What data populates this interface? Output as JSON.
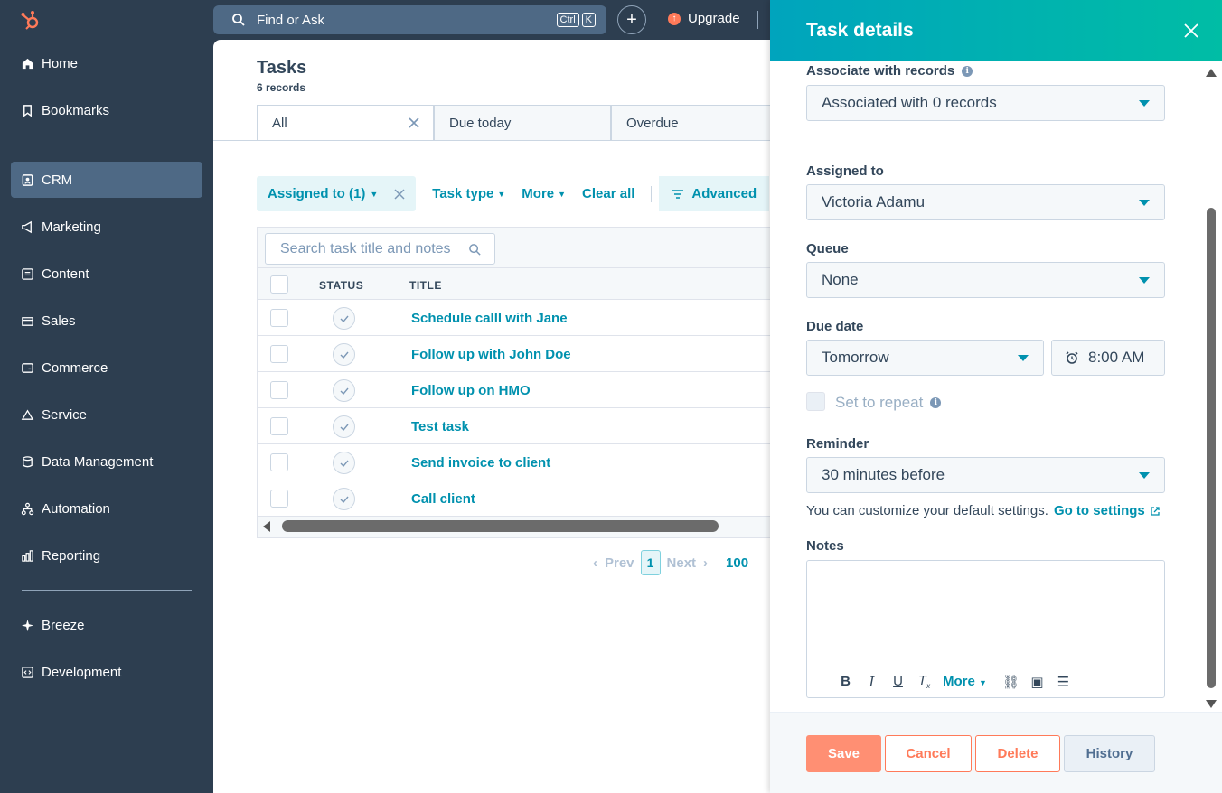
{
  "sidebar": {
    "items": [
      {
        "label": "Home",
        "icon": "home-icon"
      },
      {
        "label": "Bookmarks",
        "icon": "bookmark-icon"
      },
      {
        "label": "CRM",
        "icon": "crm-icon",
        "active": true
      },
      {
        "label": "Marketing",
        "icon": "megaphone-icon"
      },
      {
        "label": "Content",
        "icon": "content-icon"
      },
      {
        "label": "Sales",
        "icon": "sales-icon"
      },
      {
        "label": "Commerce",
        "icon": "commerce-icon"
      },
      {
        "label": "Service",
        "icon": "service-icon"
      },
      {
        "label": "Data Management",
        "icon": "database-icon"
      },
      {
        "label": "Automation",
        "icon": "automation-icon"
      },
      {
        "label": "Reporting",
        "icon": "reporting-icon"
      },
      {
        "label": "Breeze",
        "icon": "sparkle-icon"
      },
      {
        "label": "Development",
        "icon": "code-icon"
      }
    ]
  },
  "topbar": {
    "search_label": "Find or Ask",
    "kbd_1": "Ctrl",
    "kbd_2": "K",
    "upgrade_label": "Upgrade"
  },
  "main": {
    "title": "Tasks",
    "subtitle": "6 records",
    "tabs": [
      {
        "label": "All"
      },
      {
        "label": "Due today"
      },
      {
        "label": "Overdue"
      }
    ],
    "filters": {
      "assigned": "Assigned to (1)",
      "task_type": "Task type",
      "more": "More",
      "clear_all": "Clear all",
      "advanced": "Advanced"
    },
    "table": {
      "search_placeholder": "Search task title and notes",
      "columns": {
        "status": "STATUS",
        "title": "TITLE"
      },
      "rows": [
        {
          "title": "Schedule calll with Jane"
        },
        {
          "title": "Follow up with John Doe"
        },
        {
          "title": "Follow up on HMO"
        },
        {
          "title": "Test task"
        },
        {
          "title": "Send invoice to client"
        },
        {
          "title": "Call client"
        }
      ]
    },
    "pager": {
      "prev": "Prev",
      "page": "1",
      "next": "Next",
      "per_page": "100"
    }
  },
  "panel": {
    "title": "Task details",
    "associate_label": "Associate with records",
    "associate_value": "Associated with 0 records",
    "assigned_label": "Assigned to",
    "assigned_value": "Victoria Adamu",
    "queue_label": "Queue",
    "queue_value": "None",
    "due_label": "Due date",
    "due_value": "Tomorrow",
    "due_time": "8:00 AM",
    "repeat_label": "Set to repeat",
    "reminder_label": "Reminder",
    "reminder_value": "30 minutes before",
    "hint_text": "You can customize your default settings.",
    "hint_link": "Go to settings",
    "notes_label": "Notes",
    "rte_more": "More",
    "buttons": {
      "save": "Save",
      "cancel": "Cancel",
      "delete": "Delete",
      "history": "History"
    }
  },
  "colors": {
    "sidebar_bg": "#2d3e50",
    "accent": "#0091ae",
    "primary_orange": "#ff7a59",
    "panel_header_start": "#00a4bd",
    "panel_header_end": "#00bda5"
  }
}
